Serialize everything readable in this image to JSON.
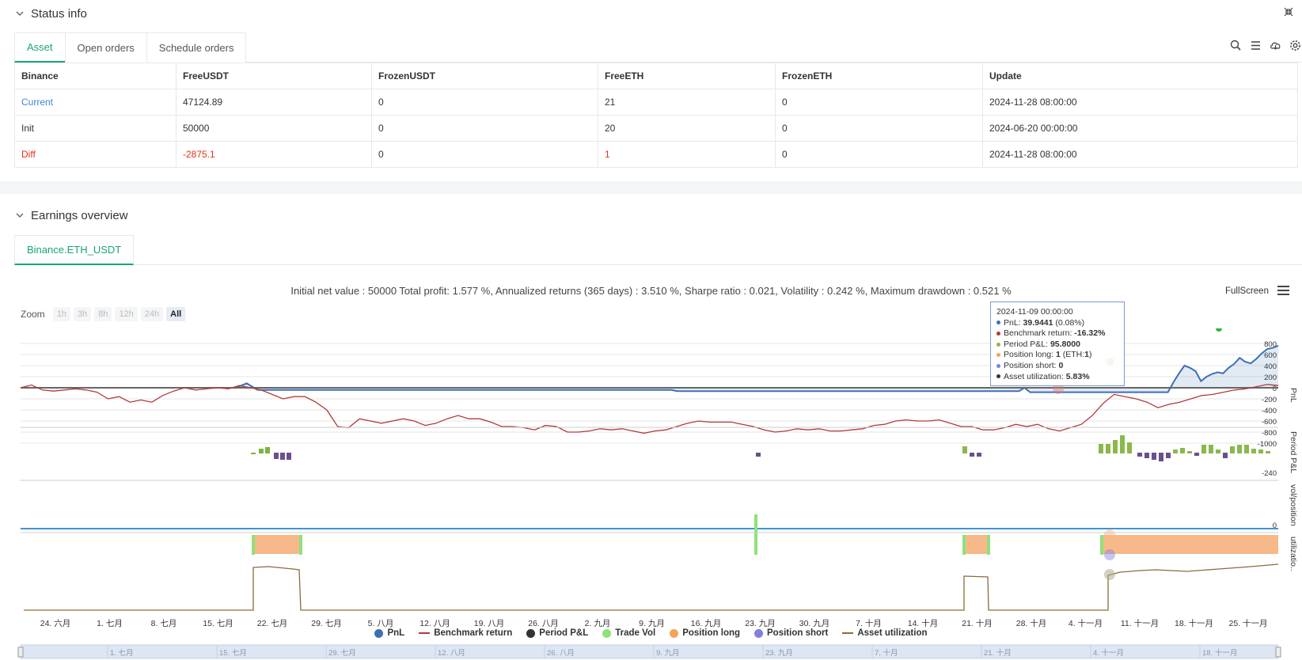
{
  "status": {
    "title": "Status info",
    "tabs": [
      "Asset",
      "Open orders",
      "Schedule orders"
    ],
    "table": {
      "headers": [
        "Binance",
        "FreeUSDT",
        "FrozenUSDT",
        "FreeETH",
        "FrozenETH",
        "Update"
      ],
      "rows": [
        [
          "Current",
          "47124.89",
          "0",
          "21",
          "0",
          "2024-11-28 08:00:00"
        ],
        [
          "Init",
          "50000",
          "0",
          "20",
          "0",
          "2024-06-20 00:00:00"
        ],
        [
          "Diff",
          "-2875.1",
          "0",
          "1",
          "0",
          "2024-11-28 08:00:00"
        ]
      ]
    }
  },
  "earnings": {
    "title": "Earnings overview",
    "tabs": [
      "Binance.ETH_USDT"
    ],
    "summary": "Initial net value : 50000 Total profit: 1.577 %, Annualized returns (365 days) : 3.510 %, Sharpe ratio : 0.021, Volatility : 0.242 %, Maximum drawdown : 0.521 %",
    "fullscreen": "FullScreen",
    "zoom_label": "Zoom",
    "zoom_buttons": [
      "1h",
      "3h",
      "8h",
      "12h",
      "24h",
      "All"
    ],
    "tooltip": {
      "date": "2024-11-09 00:00:00",
      "pnl_label": "PnL: ",
      "pnl_value": "39.9441",
      "pnl_extra": " (0.08%)",
      "bench_label": "Benchmark return: ",
      "bench_value": "-16.32%",
      "period_label": "Period P&L: ",
      "period_value": "95.8000",
      "long_label": "Position long: ",
      "long_value": "1",
      "long_extra": " (ETH:",
      "long_extra2": "1",
      "long_extra3": ")",
      "short_label": "Position short: ",
      "short_value": "0",
      "util_label": "Asset utilization: ",
      "util_value": "5.83%"
    },
    "legend": [
      {
        "name": "PnL",
        "color": "#3d6fb6"
      },
      {
        "name": "Benchmark return",
        "color": "#b23a3a"
      },
      {
        "name": "Period P&L",
        "color": "#333333"
      },
      {
        "name": "Trade Vol",
        "color": "#8de27a"
      },
      {
        "name": "Position long",
        "color": "#f5a35c"
      },
      {
        "name": "Position short",
        "color": "#8080e0"
      },
      {
        "name": "Asset utilization",
        "color": "#8a6d3b"
      }
    ]
  },
  "chart_data": {
    "type": "line",
    "x_ticks": [
      "24. 六月",
      "1. 七月",
      "8. 七月",
      "15. 七月",
      "22. 七月",
      "29. 七月",
      "5. 八月",
      "12. 八月",
      "19. 八月",
      "26. 八月",
      "2. 九月",
      "9. 九月",
      "16. 九月",
      "23. 九月",
      "30. 九月",
      "7. 十月",
      "14. 十月",
      "21. 十月",
      "28. 十月",
      "4. 十一月",
      "11. 十一月",
      "18. 十一月",
      "25. 十一月"
    ],
    "navigator_ticks": [
      "1. 七月",
      "15. 七月",
      "29. 七月",
      "12. 八月",
      "26. 八月",
      "9. 九月",
      "23. 九月",
      "7. 十月",
      "21. 十月",
      "4. 十一月",
      "18. 十一月"
    ],
    "pnl_axis": [
      "800",
      "600",
      "400",
      "200",
      "0",
      "-200",
      "-400",
      "-600",
      "-800",
      "-1000"
    ],
    "pnl_axis_label": "PnL",
    "period_axis": [
      "-240"
    ],
    "period_axis_label": "Period P&L",
    "vol_axis": [
      "0"
    ],
    "vol_axis_label": "vol/position",
    "util_axis_label": "utilizatio..",
    "pnl": [
      0,
      0,
      0,
      0,
      0,
      0,
      0,
      0,
      0,
      0,
      0,
      0,
      0,
      0,
      0,
      0,
      0,
      0,
      0,
      0,
      0,
      0,
      0,
      0,
      0,
      0,
      0,
      0,
      0,
      0,
      0,
      0,
      0,
      0,
      0,
      0,
      0,
      0,
      0,
      0,
      40,
      80,
      20,
      -40,
      -40,
      -40,
      -40,
      -40,
      -40,
      -40,
      -40,
      -40,
      -40,
      -40,
      -40,
      -40,
      -40,
      -40,
      -40,
      -40,
      -40,
      -40,
      -40,
      -40,
      -40,
      -40,
      -40,
      -40,
      -40,
      -40,
      -40,
      -40,
      -40,
      -40,
      -40,
      -40,
      -40,
      -40,
      -40,
      -40,
      -40,
      -40,
      -40,
      -40,
      -40,
      -40,
      -40,
      -40,
      -40,
      -40,
      -40,
      -40,
      -40,
      -40,
      -40,
      -40,
      -40,
      -40,
      -40,
      -40,
      -40,
      -40,
      -40,
      -40,
      -40,
      -40,
      -40,
      -40,
      -40,
      -40,
      -40,
      -40,
      -40,
      -40,
      -40,
      -40,
      -40,
      -40,
      -40,
      -60,
      -60,
      -60,
      -60,
      -60,
      -60,
      -60,
      -60,
      -60,
      -60,
      -60,
      -60,
      -60,
      -60,
      -60,
      -60,
      -60,
      -60,
      -60,
      -60,
      -60,
      -60,
      -60,
      -60,
      -60,
      -60,
      -60,
      -60,
      -60,
      -60,
      -60,
      -60,
      -60,
      -60,
      -60,
      -60,
      -60,
      -60,
      -60,
      -60,
      -60,
      -60,
      -60,
      -60,
      -60,
      -60,
      -60,
      -60,
      -60,
      -60,
      -60,
      -60,
      -60,
      -60,
      -60,
      -60,
      -60,
      -60,
      -60,
      -60,
      -60,
      -60,
      -60,
      0,
      -80,
      -80,
      -80,
      -80,
      -80,
      -80,
      -80,
      -80,
      -80,
      -80,
      -80,
      -80,
      -80,
      -80,
      -80,
      -80,
      -80,
      -80,
      -80,
      -80,
      -80,
      -80,
      -80,
      -80,
      -80,
      -80,
      100,
      260,
      400,
      360,
      300,
      120,
      200,
      250,
      280,
      260,
      360,
      430,
      540,
      470,
      440,
      520,
      620,
      700,
      720,
      760
    ],
    "benchmark": [
      0,
      50,
      -40,
      -60,
      -40,
      -20,
      -40,
      -80,
      -200,
      -160,
      -260,
      -220,
      -260,
      -140,
      -60,
      0,
      -40,
      -20,
      0,
      -20,
      40,
      0,
      -40,
      -120,
      -200,
      -160,
      -160,
      -260,
      -400,
      -700,
      -720,
      -560,
      -600,
      -640,
      -600,
      -560,
      -600,
      -680,
      -640,
      -560,
      -500,
      -560,
      -560,
      -620,
      -700,
      -700,
      -720,
      -760,
      -680,
      -700,
      -800,
      -800,
      -780,
      -740,
      -760,
      -740,
      -780,
      -820,
      -780,
      -760,
      -700,
      -640,
      -600,
      -620,
      -620,
      -620,
      -660,
      -700,
      -760,
      -800,
      -780,
      -740,
      -760,
      -740,
      -780,
      -780,
      -760,
      -740,
      -680,
      -660,
      -600,
      -580,
      -600,
      -600,
      -580,
      -640,
      -700,
      -700,
      -760,
      -760,
      -720,
      -660,
      -700,
      -660,
      -740,
      -780,
      -720,
      -660,
      -500,
      -280,
      -120,
      -160,
      -200,
      -260,
      -360,
      -300,
      -260,
      -200,
      -140,
      -120,
      -80,
      -40,
      -20,
      20,
      60,
      40
    ]
  }
}
